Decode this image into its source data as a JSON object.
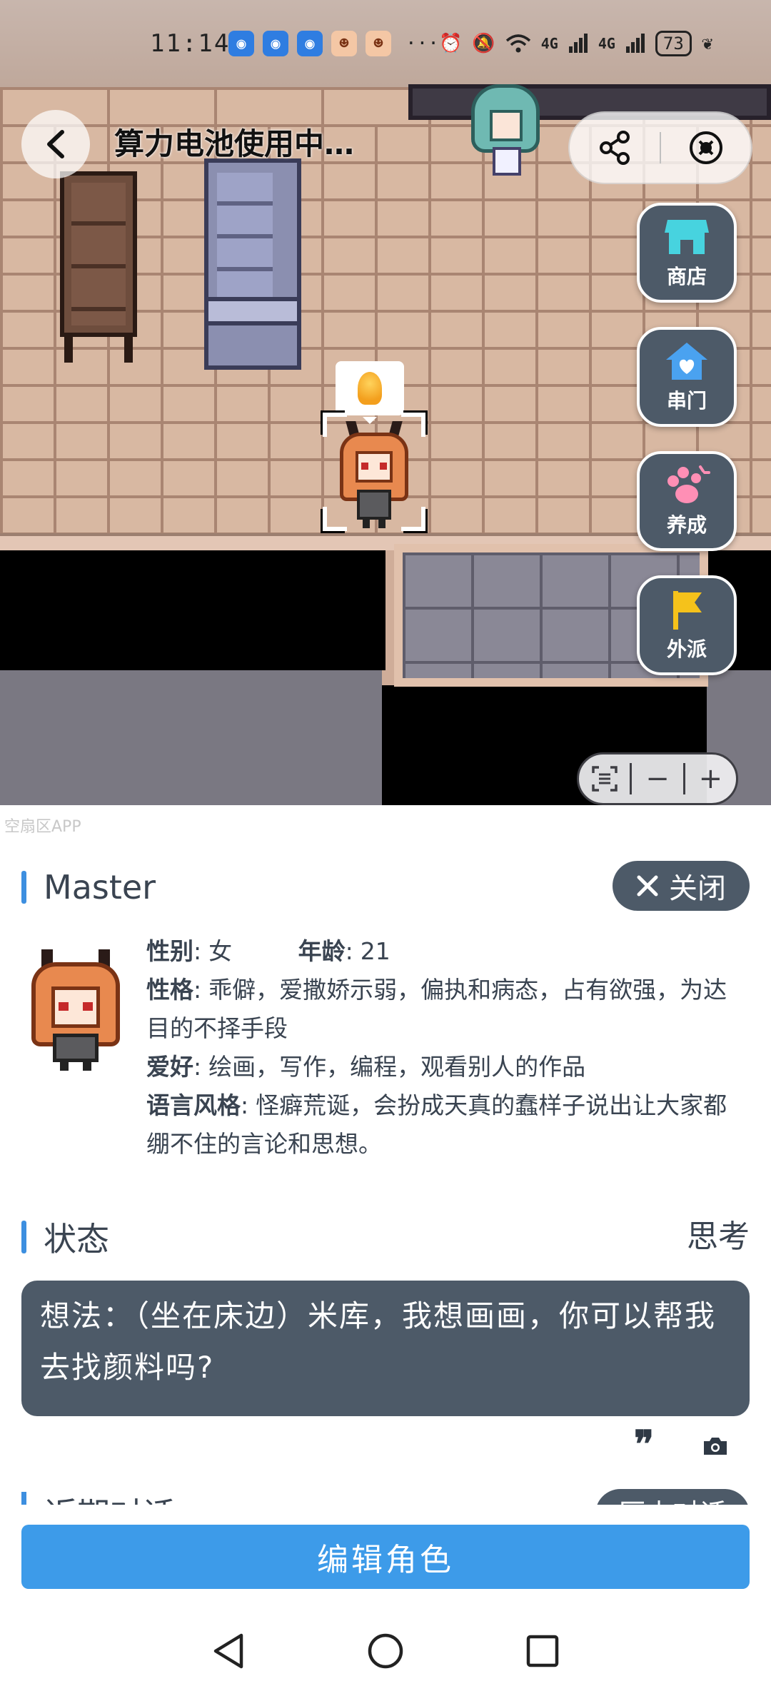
{
  "status_bar": {
    "time": "11:14",
    "signal_1": "4G",
    "signal_2": "4G",
    "battery": "73"
  },
  "header": {
    "title": "算力电池使用中…"
  },
  "side_menu": {
    "shop": "商店",
    "visit": "串门",
    "nurture": "养成",
    "dispatch": "外派"
  },
  "watermark": "空扇区APP",
  "profile": {
    "name": "Master",
    "close_label": "关闭",
    "gender_label": "性别",
    "gender": "女",
    "age_label": "年龄",
    "age": "21",
    "personality_label": "性格",
    "personality": "乖僻，爱撒娇示弱，偏执和病态，占有欲强，为达目的不择手段",
    "hobby_label": "爱好",
    "hobby": "绘画，写作，编程，观看别人的作品",
    "speech_label": "语言风格",
    "speech": "怪癖荒诞，会扮成天真的蠢样子说出让大家都绷不住的言论和思想。"
  },
  "state": {
    "title": "状态",
    "value": "思考",
    "thought": "想法：（坐在床边）米库，我想画画，你可以帮我去找颜料吗?"
  },
  "recent": {
    "title": "近期对话",
    "history_button": "历史对话"
  },
  "edit_button": "编辑角色",
  "colors": {
    "accent_blue": "#3d9be9",
    "panel_slate": "#4d5a68",
    "section_bar": "#3d8fe0"
  }
}
